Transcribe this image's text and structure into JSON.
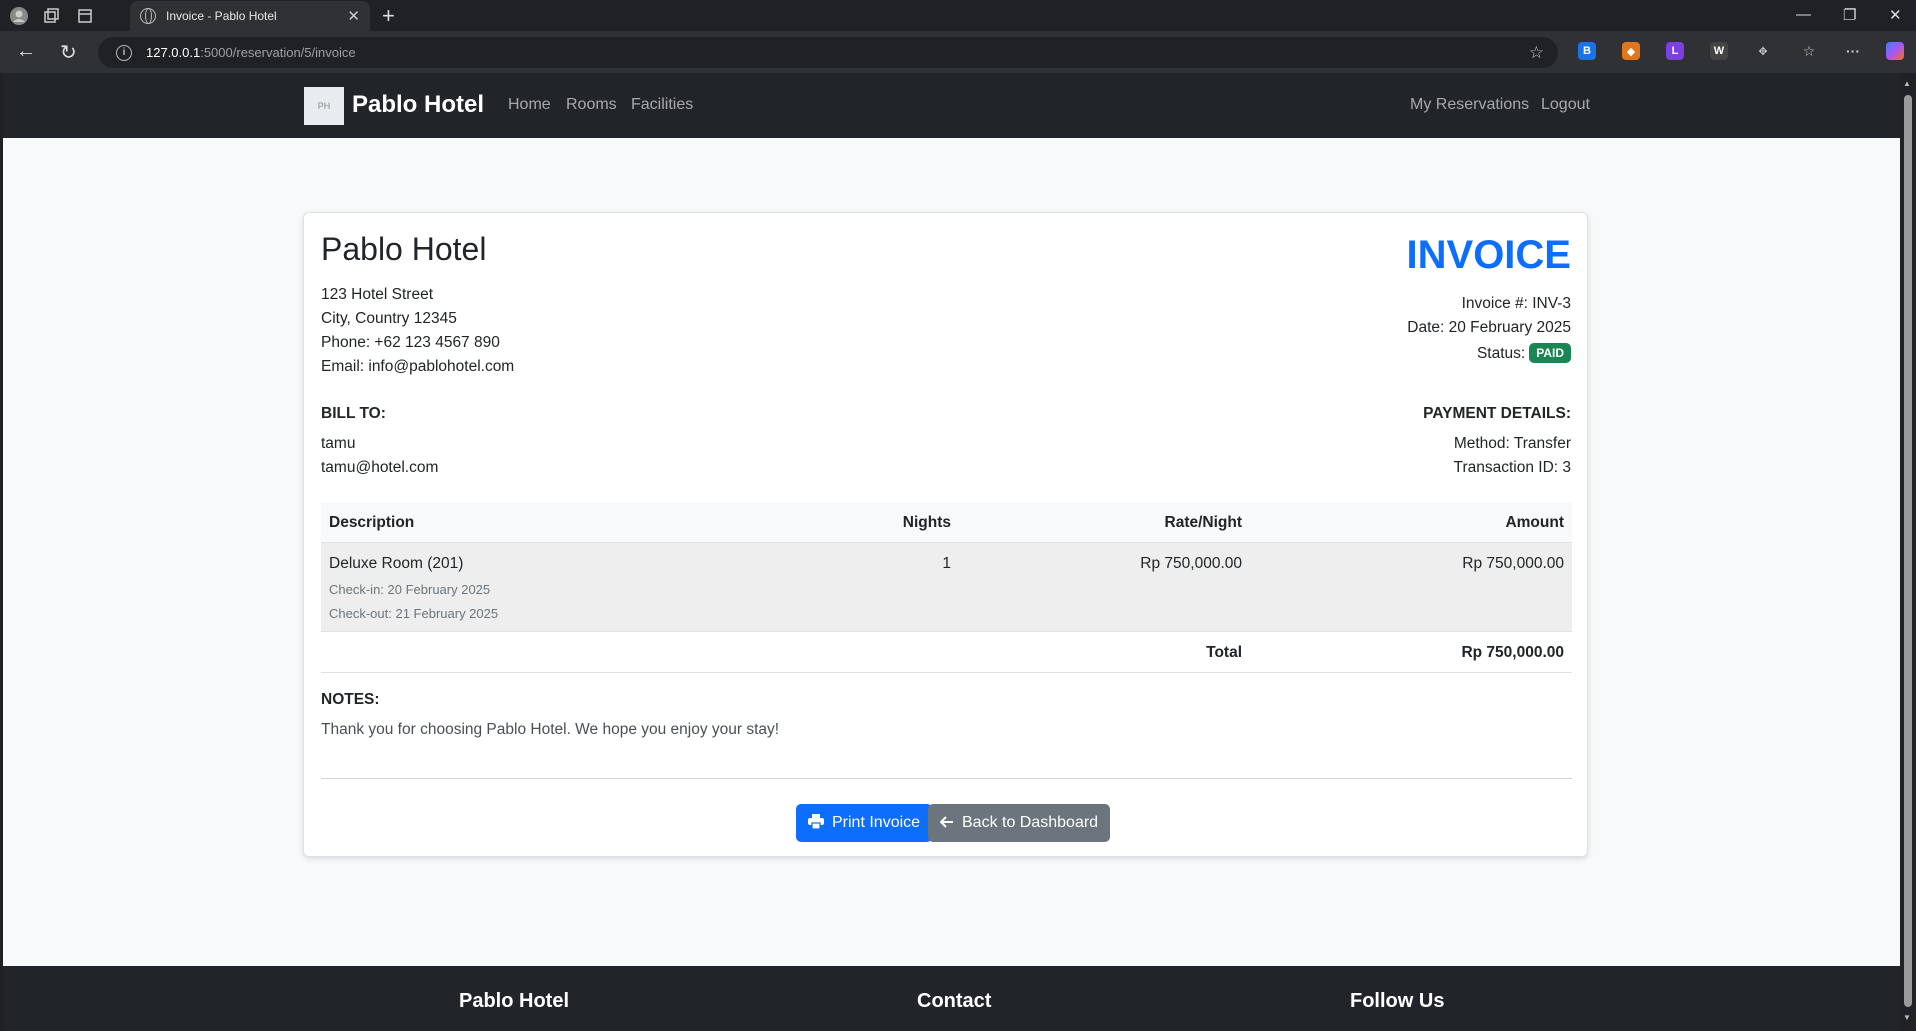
{
  "browser": {
    "tab_title": "Invoice - Pablo Hotel",
    "url_host": "127.0.0.1",
    "url_path": ":5000/reservation/5/invoice"
  },
  "nav": {
    "brand": "Pablo Hotel",
    "logo_text": "PH",
    "links": [
      "Home",
      "Rooms",
      "Facilities"
    ],
    "right_links": [
      "My Reservations",
      "Logout"
    ]
  },
  "invoice": {
    "hotel_name": "Pablo Hotel",
    "address": [
      "123 Hotel Street",
      "City, Country 12345",
      "Phone: +62 123 4567 890",
      "Email: info@pablohotel.com"
    ],
    "title": "INVOICE",
    "number": "Invoice #: INV-3",
    "date": "Date: 20 February 2025",
    "status_label": "Status:",
    "status": "PAID",
    "bill_to_heading": "BILL TO:",
    "bill_to": [
      "tamu",
      "tamu@hotel.com"
    ],
    "payment_heading": "PAYMENT DETAILS:",
    "payment": [
      "Method: Transfer",
      "Transaction ID: 3"
    ],
    "table": {
      "headers": [
        "Description",
        "Nights",
        "Rate/Night",
        "Amount"
      ],
      "row": {
        "description": "Deluxe Room (201)",
        "checkin": "Check-in: 20 February 2025",
        "checkout": "Check-out: 21 February 2025",
        "nights": "1",
        "rate": "Rp 750,000.00",
        "amount": "Rp 750,000.00"
      },
      "total_label": "Total",
      "total": "Rp 750,000.00"
    },
    "notes_heading": "NOTES:",
    "notes": "Thank you for choosing Pablo Hotel. We hope you enjoy your stay!",
    "print_button": "Print Invoice",
    "back_button": "Back to Dashboard"
  },
  "footer": {
    "headings": [
      "Pablo Hotel",
      "Contact",
      "Follow Us"
    ]
  },
  "colors": {
    "primary": "#0d6efd",
    "success": "#198754",
    "secondary": "#6c757d",
    "dark": "#212529"
  }
}
